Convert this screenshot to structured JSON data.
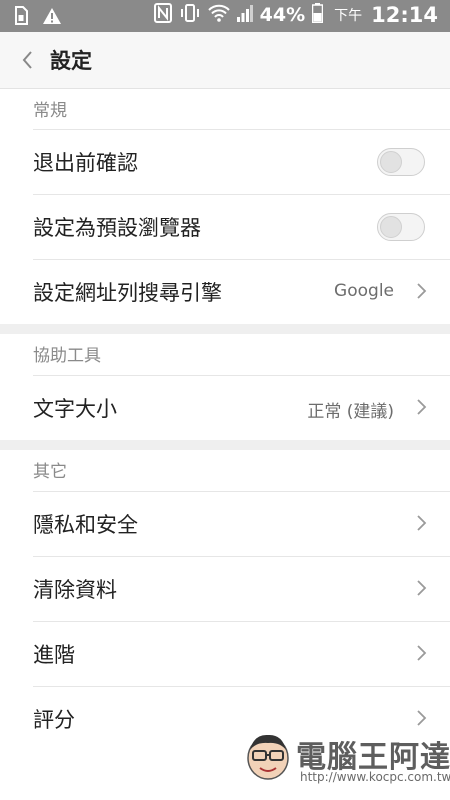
{
  "status_bar": {
    "battery_percent": "44%",
    "ampm": "下午",
    "time": "12:14",
    "icons": [
      "sim-card-icon",
      "warning-icon",
      "nfc-icon",
      "vibrate-icon",
      "wifi-icon",
      "signal-icon",
      "battery-icon"
    ]
  },
  "header": {
    "title": "設定",
    "back_icon": "chevron-left-icon"
  },
  "sections": {
    "general": {
      "title": "常規",
      "rows": {
        "confirm_exit": {
          "label": "退出前確認",
          "toggle": "off"
        },
        "default_browser": {
          "label": "設定為預設瀏覽器",
          "toggle": "off"
        },
        "search_engine": {
          "label": "設定網址列搜尋引擎",
          "value": "Google"
        }
      }
    },
    "accessibility": {
      "title": "協助工具",
      "rows": {
        "text_size": {
          "label": "文字大小",
          "value": "正常 (建議)"
        }
      }
    },
    "other": {
      "title": "其它",
      "rows": {
        "privacy": {
          "label": "隱私和安全"
        },
        "clear_data": {
          "label": "清除資料"
        },
        "advanced": {
          "label": "進階"
        },
        "rate": {
          "label": "評分"
        }
      }
    }
  },
  "watermark": {
    "text": "電腦王阿達",
    "url": "http://www.kocpc.com.tw"
  },
  "colors": {
    "status_bar": "#8a8a8a",
    "header_bg": "#f7f7f7",
    "section_title": "#8a8a8a",
    "separator_band": "#efefef"
  }
}
